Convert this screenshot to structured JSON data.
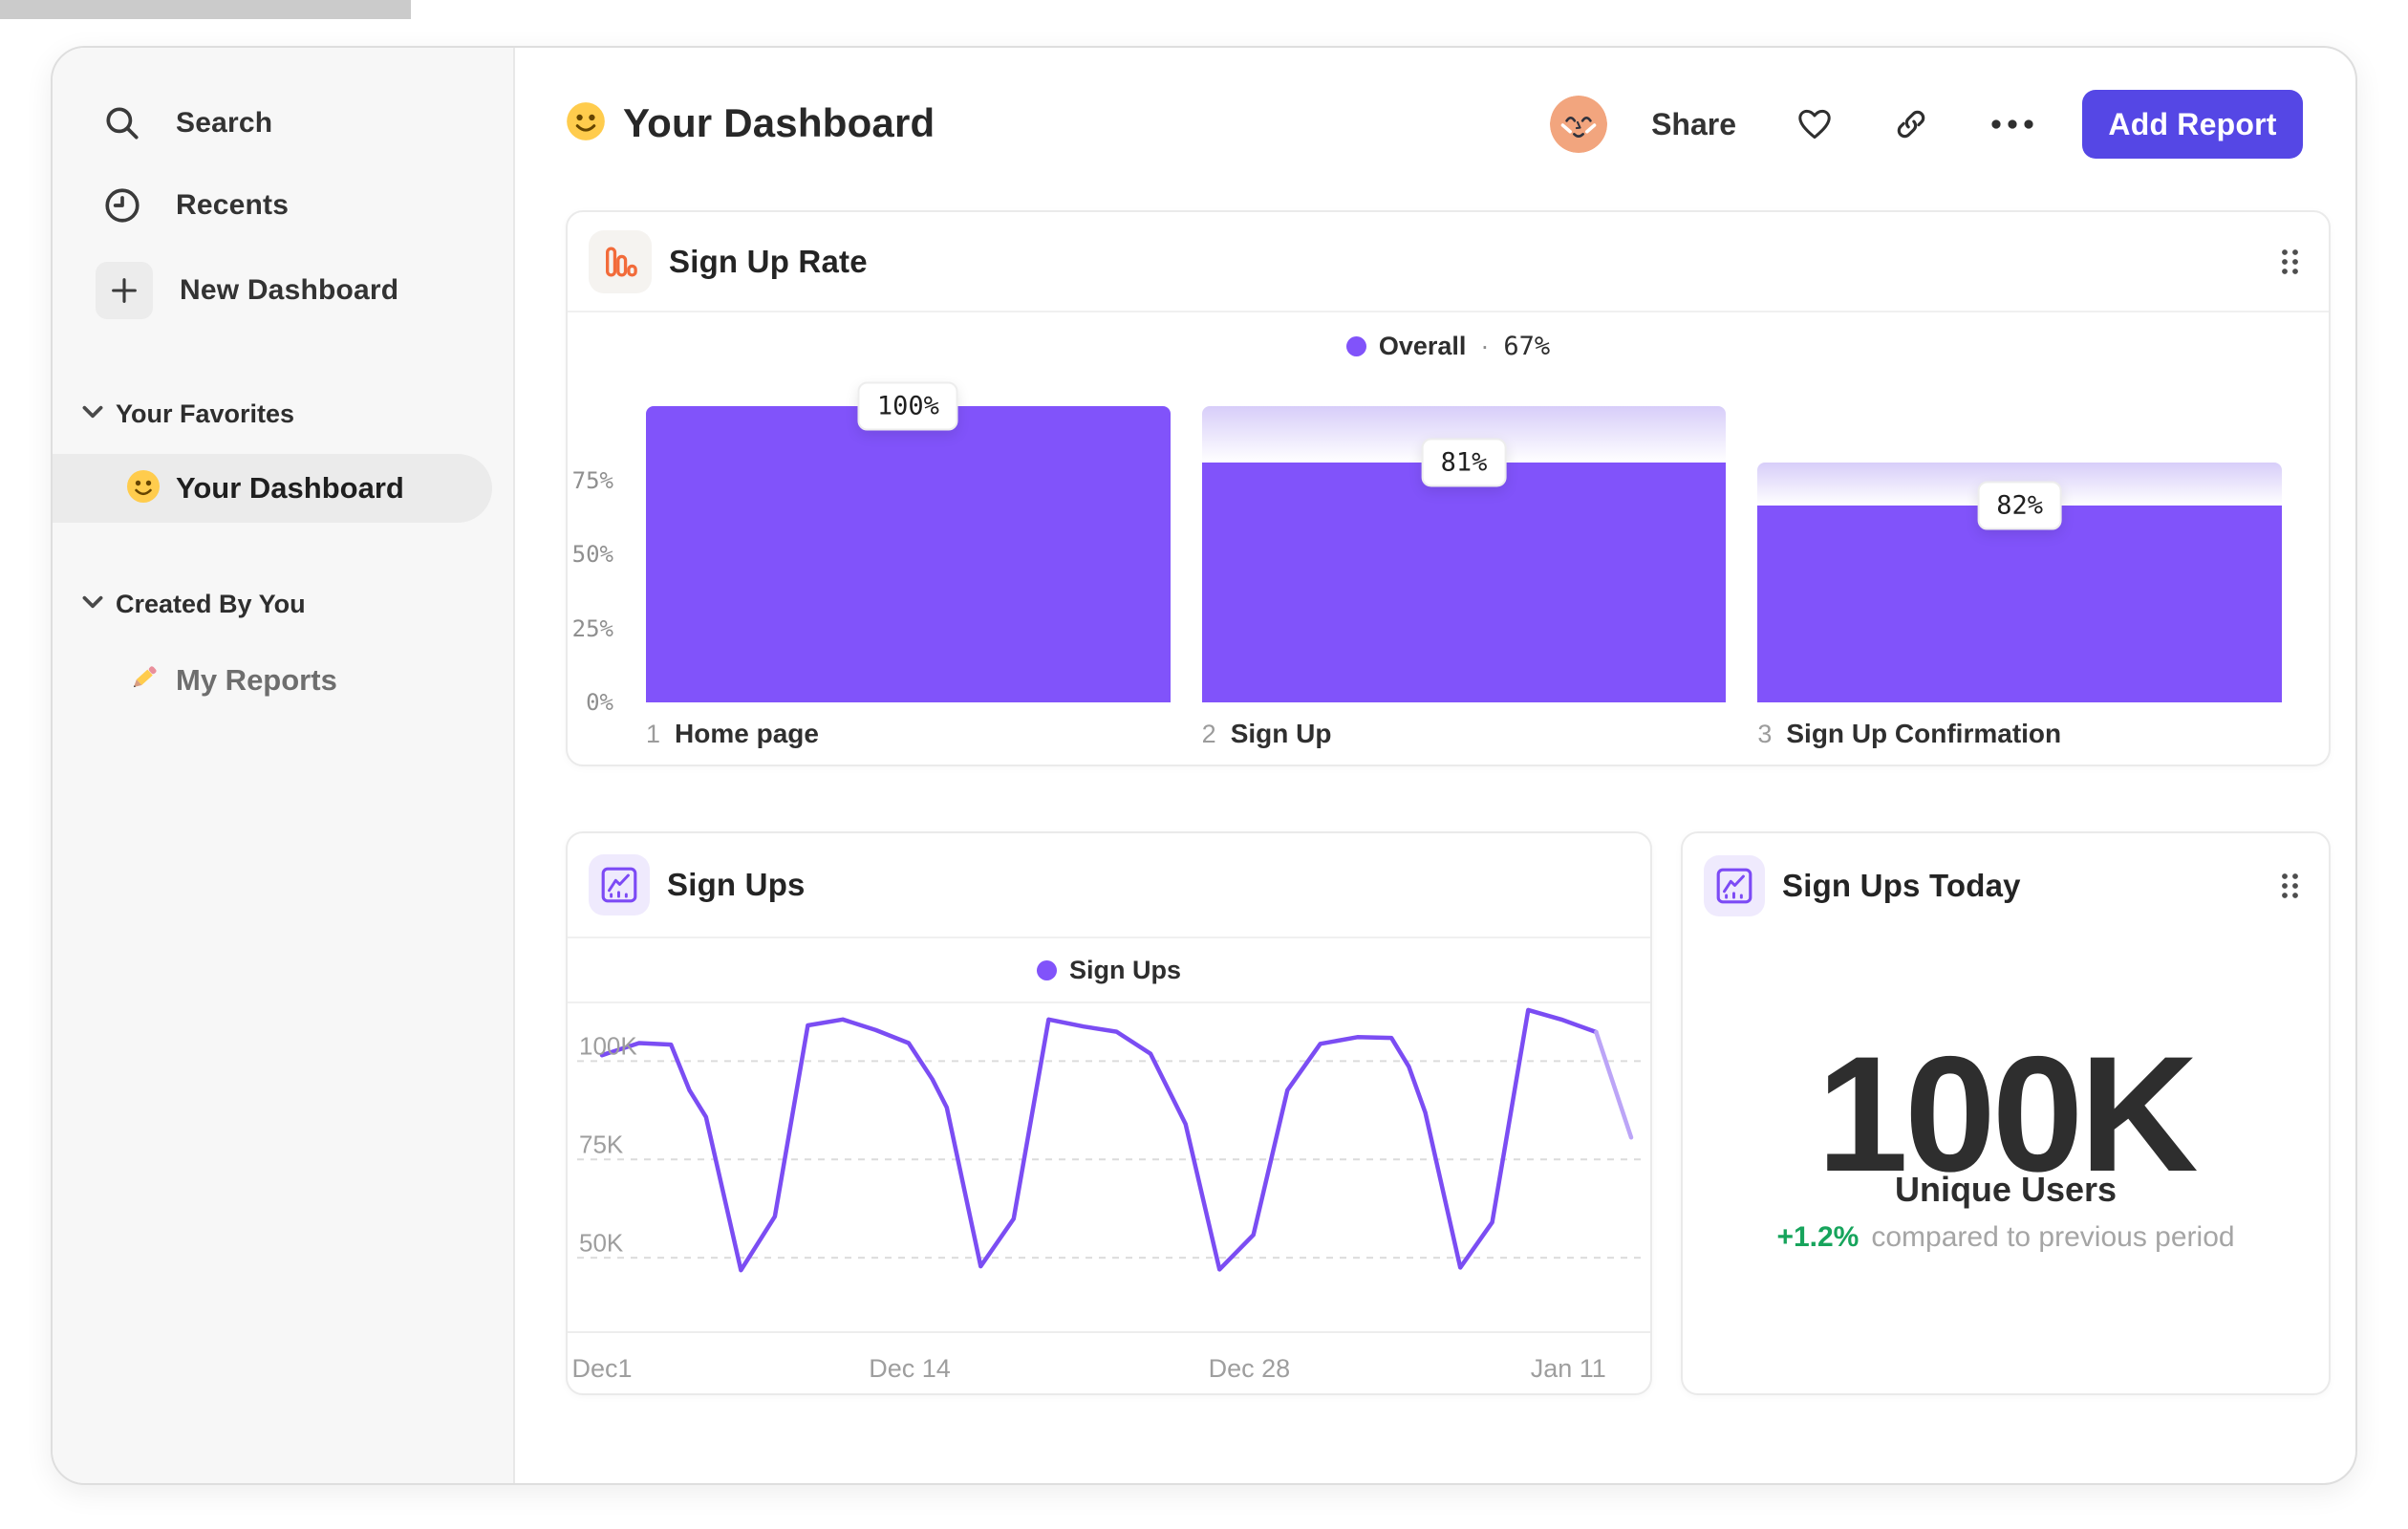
{
  "sidebar": {
    "nav": [
      {
        "label": "Search",
        "icon": "search-icon"
      },
      {
        "label": "Recents",
        "icon": "clock-icon"
      },
      {
        "label": "New Dashboard",
        "icon": "plus-icon"
      }
    ],
    "sections": [
      {
        "title": "Your Favorites",
        "items": [
          {
            "label": "Your Dashboard",
            "icon": "smiley-emoji",
            "selected": true
          }
        ]
      },
      {
        "title": "Created By You",
        "items": [
          {
            "label": "My Reports",
            "icon": "pencil-emoji",
            "selected": false
          }
        ]
      }
    ]
  },
  "header": {
    "title": "Your Dashboard",
    "emoji": "smiley",
    "share_label": "Share",
    "add_report_label": "Add Report"
  },
  "colors": {
    "accent_purple": "#8153FA",
    "ghost_gradient_top": "#D7CDF9",
    "line_purple": "#7B4DF3",
    "line_faded": "#BCA5F7",
    "button_indigo": "#5547E5",
    "icon_orange": "#F26B3A",
    "positive_green": "#17A45C"
  },
  "cards": {
    "funnel": {
      "title": "Sign Up Rate"
    },
    "line": {
      "title": "Sign Ups"
    },
    "stat": {
      "title": "Sign Ups Today",
      "value": "100K",
      "unit_label": "Unique Users",
      "delta": "+1.2%",
      "caption": "compared to previous period"
    }
  },
  "chart_data": [
    {
      "type": "bar",
      "subtype": "funnel",
      "title": "Sign Up Rate",
      "legend": {
        "series": "Overall",
        "separator": "·",
        "value": "67%"
      },
      "ylim": [
        0,
        100
      ],
      "grid": false,
      "y_ticks": [
        {
          "label": "75%",
          "pct": 75
        },
        {
          "label": "50%",
          "pct": 50
        },
        {
          "label": "25%",
          "pct": 25
        },
        {
          "label": "0%",
          "pct": 0
        }
      ],
      "steps": [
        {
          "num": "1",
          "label": "Home page",
          "value_label": "100%",
          "conversion_from_previous_pct": 100,
          "cumulative_pct": 100,
          "previous_cumulative_pct": 100
        },
        {
          "num": "2",
          "label": "Sign Up",
          "value_label": "81%",
          "conversion_from_previous_pct": 81,
          "cumulative_pct": 81,
          "previous_cumulative_pct": 100
        },
        {
          "num": "3",
          "label": "Sign Up Confirmation",
          "value_label": "82%",
          "conversion_from_previous_pct": 82,
          "cumulative_pct": 66.5,
          "previous_cumulative_pct": 81
        }
      ]
    },
    {
      "type": "line",
      "title": "Sign Ups",
      "legend": "Sign Ups",
      "ylabel": "",
      "unit": "K",
      "ylim": [
        31.3,
        114.2
      ],
      "gridlines": [
        {
          "label": "100K",
          "value": 100
        },
        {
          "label": "75K",
          "value": 75
        },
        {
          "label": "50K",
          "value": 50
        }
      ],
      "x_ticks": [
        {
          "label": "Dec1",
          "f": 0.0
        },
        {
          "label": "Dec 14",
          "f": 0.299
        },
        {
          "label": "Dec 28",
          "f": 0.629
        },
        {
          "label": "Jan 11",
          "f": 0.939
        }
      ],
      "points": [
        {
          "f": 0.0,
          "v": 101.5
        },
        {
          "f": 0.036,
          "v": 104.6
        },
        {
          "f": 0.067,
          "v": 104.2
        },
        {
          "f": 0.085,
          "v": 92.6
        },
        {
          "f": 0.101,
          "v": 85.8
        },
        {
          "f": 0.135,
          "v": 46.8
        },
        {
          "f": 0.168,
          "v": 60.5
        },
        {
          "f": 0.2,
          "v": 109.1
        },
        {
          "f": 0.234,
          "v": 110.6
        },
        {
          "f": 0.266,
          "v": 107.9
        },
        {
          "f": 0.298,
          "v": 104.6
        },
        {
          "f": 0.321,
          "v": 95.4
        },
        {
          "f": 0.335,
          "v": 88.2
        },
        {
          "f": 0.368,
          "v": 47.8
        },
        {
          "f": 0.4,
          "v": 59.9
        },
        {
          "f": 0.434,
          "v": 110.6
        },
        {
          "f": 0.468,
          "v": 108.8
        },
        {
          "f": 0.5,
          "v": 107.5
        },
        {
          "f": 0.533,
          "v": 101.9
        },
        {
          "f": 0.567,
          "v": 84.0
        },
        {
          "f": 0.6,
          "v": 47.0
        },
        {
          "f": 0.633,
          "v": 55.8
        },
        {
          "f": 0.666,
          "v": 92.6
        },
        {
          "f": 0.698,
          "v": 104.4
        },
        {
          "f": 0.734,
          "v": 106.1
        },
        {
          "f": 0.767,
          "v": 105.9
        },
        {
          "f": 0.784,
          "v": 98.6
        },
        {
          "f": 0.8,
          "v": 86.9
        },
        {
          "f": 0.834,
          "v": 47.5
        },
        {
          "f": 0.865,
          "v": 59.0
        },
        {
          "f": 0.9,
          "v": 113.0
        },
        {
          "f": 0.932,
          "v": 110.6
        },
        {
          "f": 0.966,
          "v": 107.4
        },
        {
          "f": 1.0,
          "v": 80.6
        }
      ],
      "faded_from_index": 32
    },
    {
      "type": "stat",
      "title": "Sign Ups Today",
      "value": "100K",
      "label": "Unique Users",
      "delta": "+1.2%",
      "caption": "compared to previous period"
    }
  ]
}
